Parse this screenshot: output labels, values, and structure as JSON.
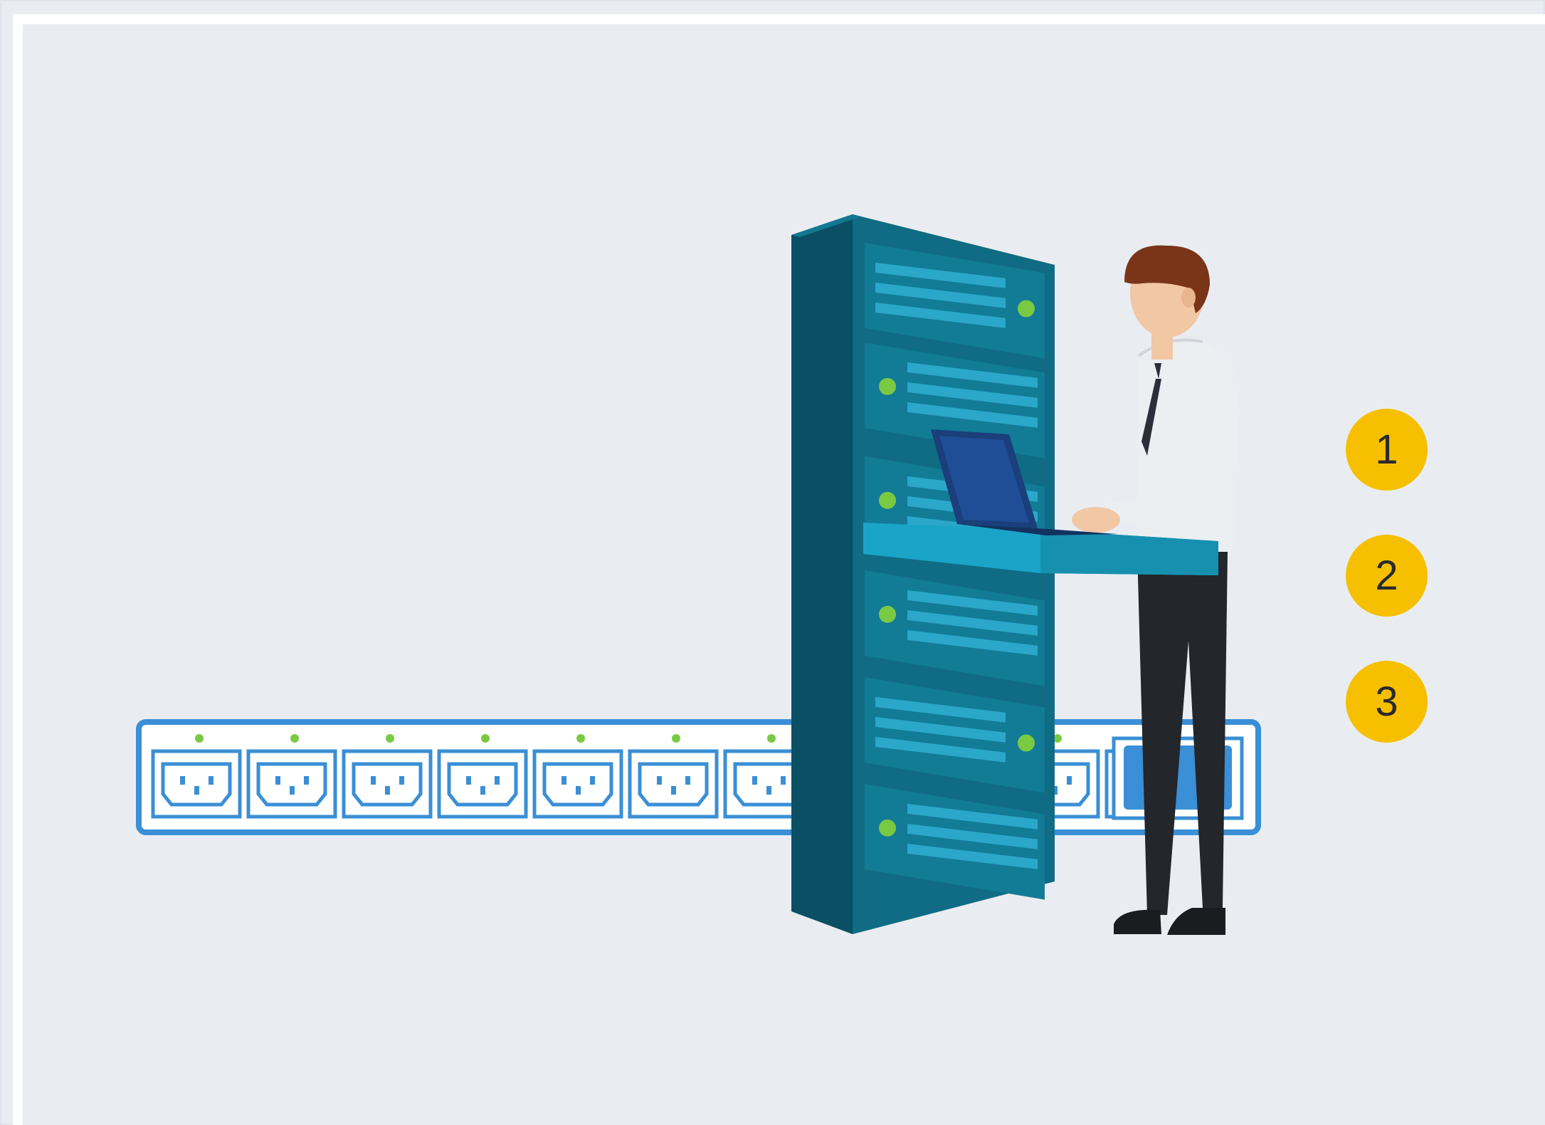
{
  "steps": {
    "items": [
      {
        "label": "1"
      },
      {
        "label": "2"
      },
      {
        "label": "3"
      }
    ]
  },
  "illustration": {
    "icons": [
      "power-strip-icon",
      "server-rack-icon",
      "technician-icon",
      "laptop-icon"
    ],
    "power_strip": {
      "outlets_visible": 12,
      "highlighted_outlet": "last"
    }
  },
  "colors": {
    "background": "#e9edf2",
    "badge": "#f6c000",
    "power_strip": "#3a8fd6",
    "rack_front": "#0f6c84",
    "rack_side": "#0a4f63",
    "led": "#7ac943"
  }
}
